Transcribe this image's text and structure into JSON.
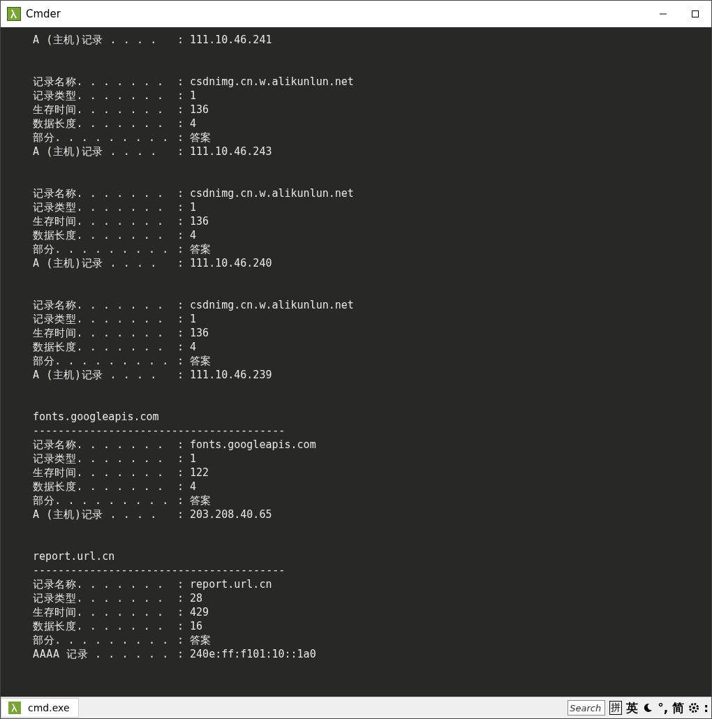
{
  "window": {
    "title": "Cmder"
  },
  "terminal": {
    "lines": [
      {
        "kind": "record",
        "label": "A (主机)记录 . . . . ",
        "value": ": 111.10.46.241"
      },
      {
        "kind": "blank"
      },
      {
        "kind": "blank"
      },
      {
        "kind": "record",
        "label": "记录名称. . . . . . . ",
        "value": ": csdnimg.cn.w.alikunlun.net"
      },
      {
        "kind": "record",
        "label": "记录类型. . . . . . . ",
        "value": ": 1"
      },
      {
        "kind": "record",
        "label": "生存时间. . . . . . . ",
        "value": ": 136"
      },
      {
        "kind": "record",
        "label": "数据长度. . . . . . . ",
        "value": ": 4"
      },
      {
        "kind": "record",
        "label": "部分. . . . . . . . . ",
        "value": ": 答案"
      },
      {
        "kind": "record",
        "label": "A (主机)记录 . . . . ",
        "value": ": 111.10.46.243"
      },
      {
        "kind": "blank"
      },
      {
        "kind": "blank"
      },
      {
        "kind": "record",
        "label": "记录名称. . . . . . . ",
        "value": ": csdnimg.cn.w.alikunlun.net"
      },
      {
        "kind": "record",
        "label": "记录类型. . . . . . . ",
        "value": ": 1"
      },
      {
        "kind": "record",
        "label": "生存时间. . . . . . . ",
        "value": ": 136"
      },
      {
        "kind": "record",
        "label": "数据长度. . . . . . . ",
        "value": ": 4"
      },
      {
        "kind": "record",
        "label": "部分. . . . . . . . . ",
        "value": ": 答案"
      },
      {
        "kind": "record",
        "label": "A (主机)记录 . . . . ",
        "value": ": 111.10.46.240"
      },
      {
        "kind": "blank"
      },
      {
        "kind": "blank"
      },
      {
        "kind": "record",
        "label": "记录名称. . . . . . . ",
        "value": ": csdnimg.cn.w.alikunlun.net"
      },
      {
        "kind": "record",
        "label": "记录类型. . . . . . . ",
        "value": ": 1"
      },
      {
        "kind": "record",
        "label": "生存时间. . . . . . . ",
        "value": ": 136"
      },
      {
        "kind": "record",
        "label": "数据长度. . . . . . . ",
        "value": ": 4"
      },
      {
        "kind": "record",
        "label": "部分. . . . . . . . . ",
        "value": ": 答案"
      },
      {
        "kind": "record",
        "label": "A (主机)记录 . . . . ",
        "value": ": 111.10.46.239"
      },
      {
        "kind": "blank"
      },
      {
        "kind": "blank"
      },
      {
        "kind": "text",
        "text": "fonts.googleapis.com"
      },
      {
        "kind": "rule",
        "text": "----------------------------------------"
      },
      {
        "kind": "record",
        "label": "记录名称. . . . . . . ",
        "value": ": fonts.googleapis.com"
      },
      {
        "kind": "record",
        "label": "记录类型. . . . . . . ",
        "value": ": 1"
      },
      {
        "kind": "record",
        "label": "生存时间. . . . . . . ",
        "value": ": 122"
      },
      {
        "kind": "record",
        "label": "数据长度. . . . . . . ",
        "value": ": 4"
      },
      {
        "kind": "record",
        "label": "部分. . . . . . . . . ",
        "value": ": 答案"
      },
      {
        "kind": "record",
        "label": "A (主机)记录 . . . . ",
        "value": ": 203.208.40.65"
      },
      {
        "kind": "blank"
      },
      {
        "kind": "blank"
      },
      {
        "kind": "text",
        "text": "report.url.cn"
      },
      {
        "kind": "rule",
        "text": "----------------------------------------"
      },
      {
        "kind": "record",
        "label": "记录名称. . . . . . . ",
        "value": ": report.url.cn"
      },
      {
        "kind": "record",
        "label": "记录类型. . . . . . . ",
        "value": ": 28"
      },
      {
        "kind": "record",
        "label": "生存时间. . . . . . . ",
        "value": ": 429"
      },
      {
        "kind": "record",
        "label": "数据长度. . . . . . . ",
        "value": ": 16"
      },
      {
        "kind": "record",
        "label": "部分. . . . . . . . . ",
        "value": ": 答案"
      },
      {
        "kind": "record",
        "label": "AAAA 记录 . . . . . . ",
        "value": ": 240e:ff:f101:10::1a0"
      }
    ]
  },
  "status_bar": {
    "tabs": [
      {
        "label": "cmd.exe",
        "selected": true
      }
    ],
    "search": {
      "placeholder": "Search"
    },
    "ime": [
      {
        "kind": "char",
        "text": "拼"
      },
      {
        "kind": "char",
        "text": "英"
      },
      {
        "kind": "moon"
      },
      {
        "kind": "char",
        "text": "°,"
      },
      {
        "kind": "char",
        "text": "简"
      },
      {
        "kind": "gear"
      },
      {
        "kind": "char",
        "text": ":"
      }
    ]
  }
}
